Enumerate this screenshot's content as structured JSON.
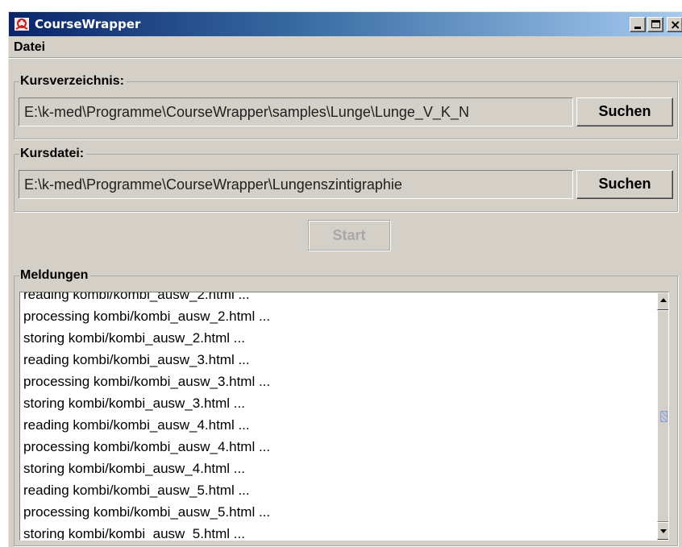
{
  "window": {
    "title": "CourseWrapper"
  },
  "menu": {
    "items": [
      "Datei"
    ]
  },
  "course_directory": {
    "label": "Kursverzeichnis:",
    "value": "E:\\k-med\\Programme\\CourseWrapper\\samples\\Lunge\\Lunge_V_K_N",
    "button": "Suchen"
  },
  "course_file": {
    "label": "Kursdatei:",
    "value": "E:\\k-med\\Programme\\CourseWrapper\\Lungenszintigraphie",
    "button": "Suchen"
  },
  "start_button": "Start",
  "messages": {
    "label": "Meldungen",
    "lines": [
      "reading kombi/kombi_ausw_2.html ...",
      "processing kombi/kombi_ausw_2.html ...",
      "storing kombi/kombi_ausw_2.html ...",
      "reading kombi/kombi_ausw_3.html ...",
      "processing kombi/kombi_ausw_3.html ...",
      "storing kombi/kombi_ausw_3.html ...",
      "reading kombi/kombi_ausw_4.html ...",
      "processing kombi/kombi_ausw_4.html ...",
      "storing kombi/kombi_ausw_4.html ...",
      "reading kombi/kombi_ausw_5.html ...",
      "processing kombi/kombi_ausw_5.html ...",
      "storing kombi/kombi_ausw_5.html ..."
    ]
  },
  "colors": {
    "titlebar_start": "#0a246a",
    "titlebar_end": "#a6caf0",
    "window_background": "#d4d0c8"
  }
}
